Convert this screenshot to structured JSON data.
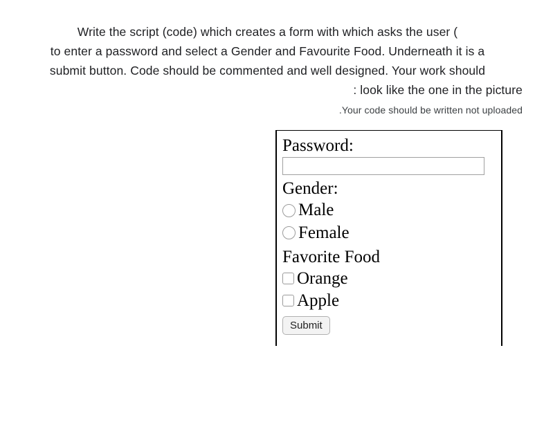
{
  "question": {
    "line1": "Write the script (code) which creates a form with which asks the user (",
    "line2": "to enter a password and select a Gender and Favourite Food. Underneath it is a",
    "line3": "submit button. Code should be commented and well designed. Your work should",
    "line4": ": look like the one in the picture",
    "subnote": ".Your code should be written not uploaded"
  },
  "form": {
    "password_label": "Password:",
    "password_value": "",
    "gender_label": "Gender:",
    "gender_options": {
      "male": "Male",
      "female": "Female"
    },
    "food_label": "Favorite Food",
    "food_options": {
      "orange": "Orange",
      "apple": "Apple"
    },
    "submit_label": "Submit"
  }
}
